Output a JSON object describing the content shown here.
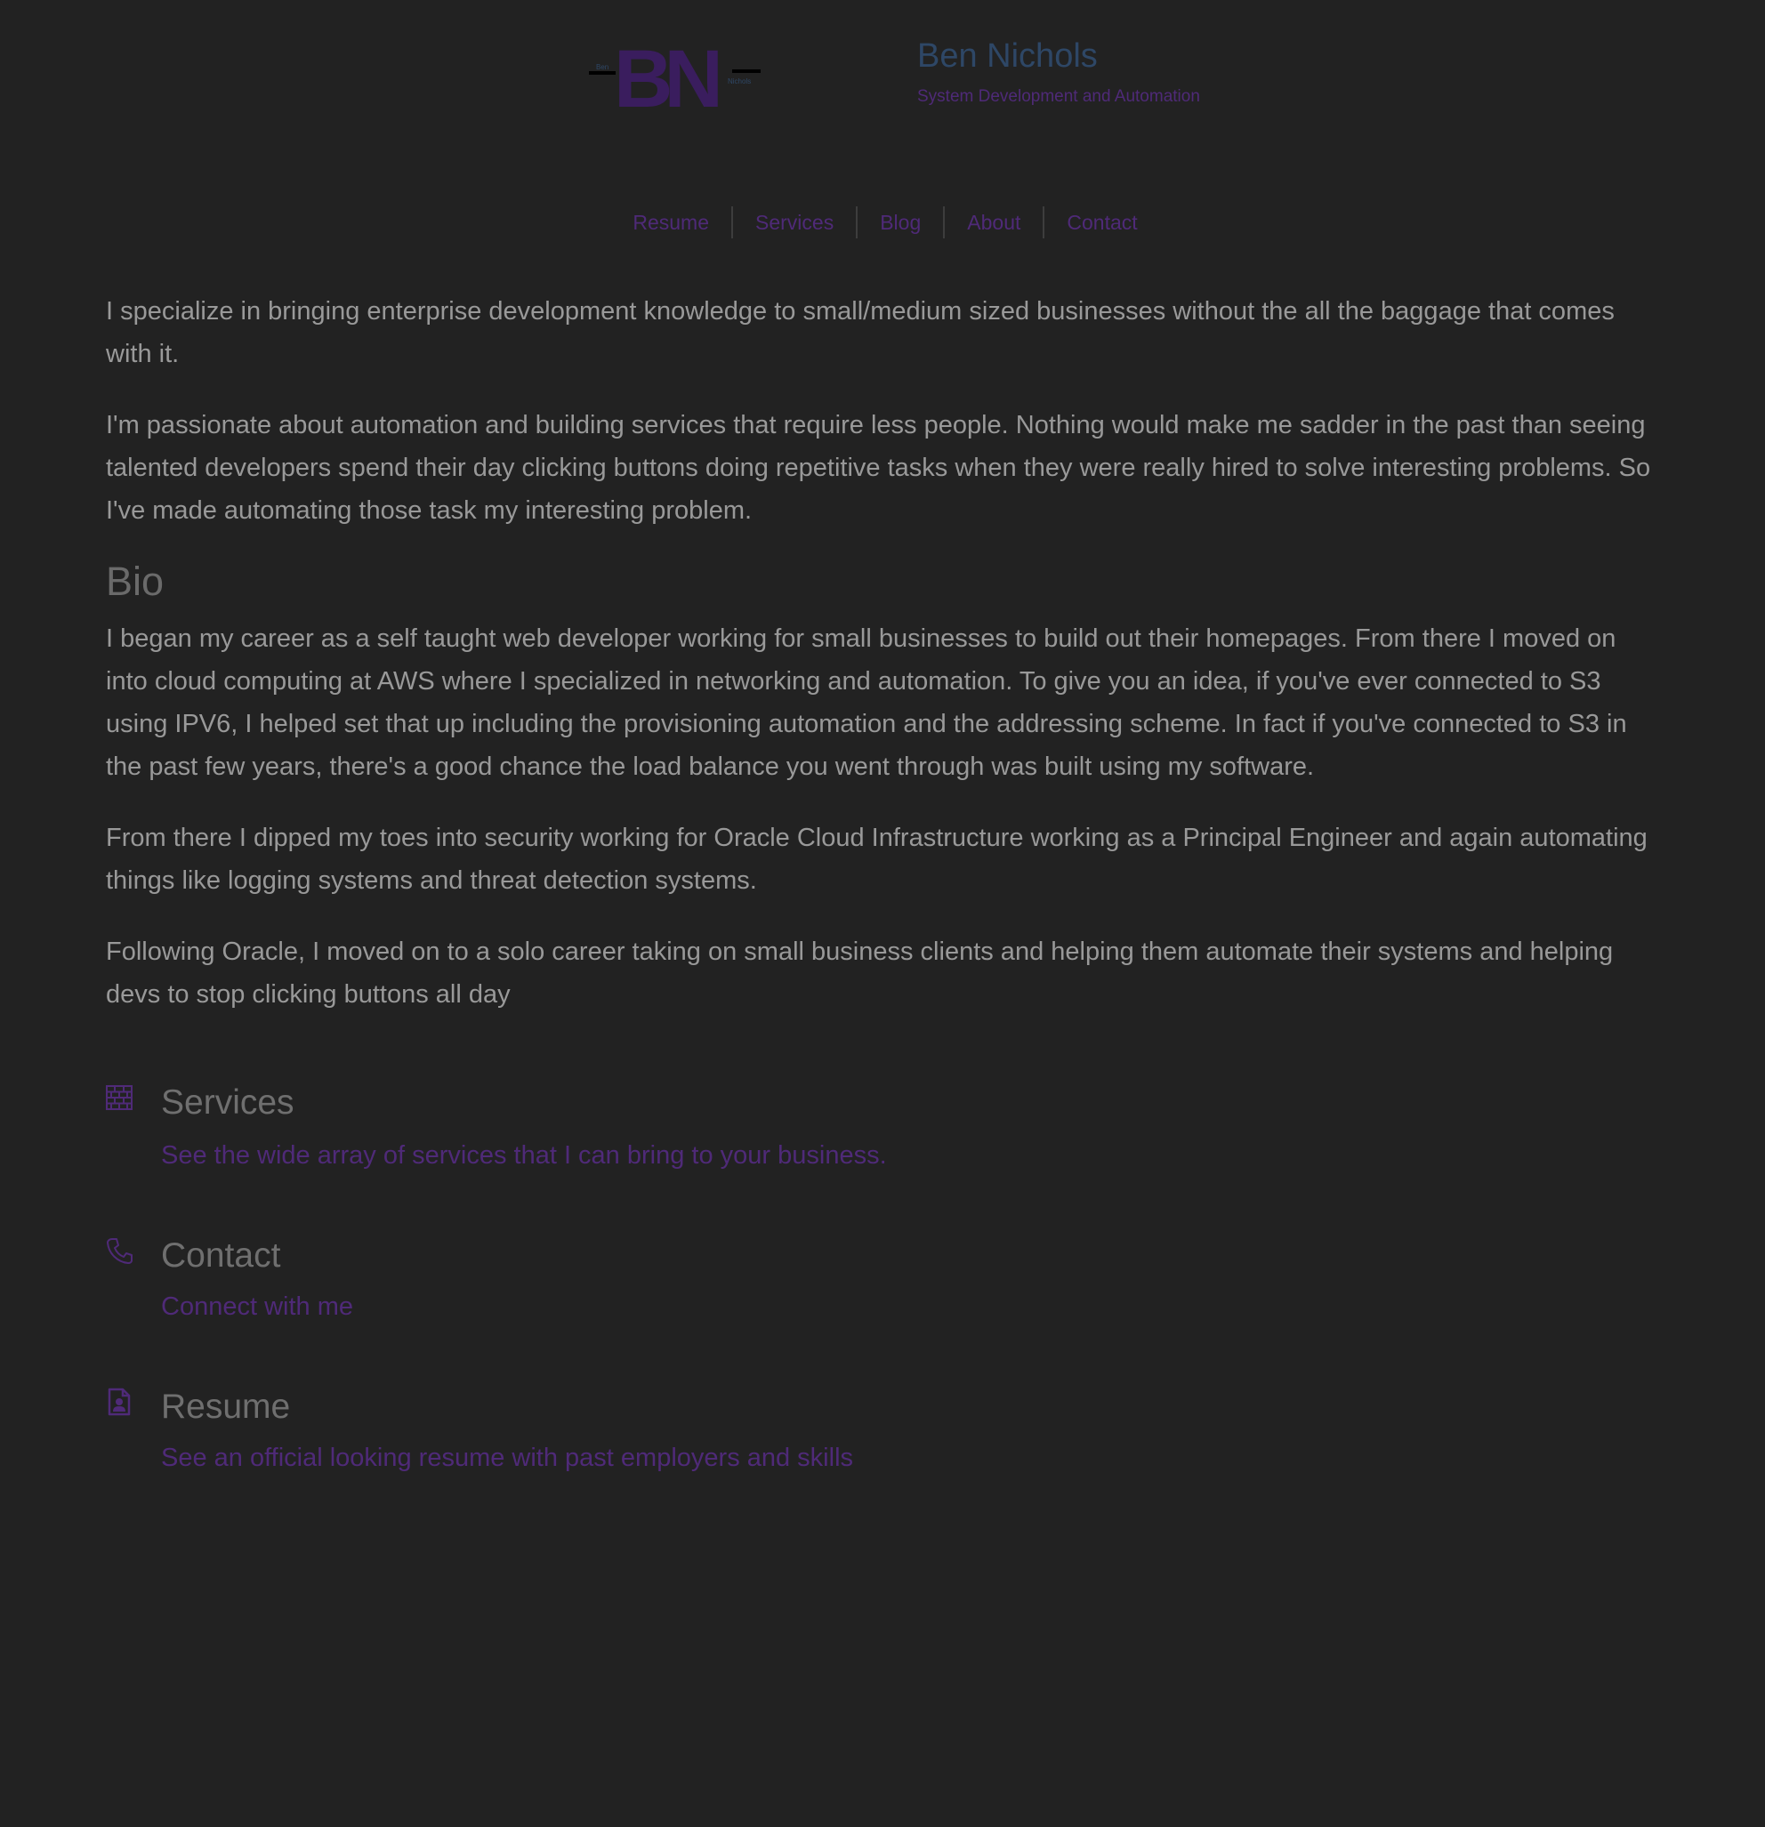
{
  "header": {
    "logo_text": "BN",
    "logo_small_left": "Ben",
    "logo_small_right": "Nichols",
    "site_name": "Ben Nichols",
    "tagline": "System Development and Automation"
  },
  "nav": {
    "items": [
      {
        "label": "Resume"
      },
      {
        "label": "Services"
      },
      {
        "label": "Blog"
      },
      {
        "label": "About"
      },
      {
        "label": "Contact"
      }
    ]
  },
  "main": {
    "intro": [
      "I specialize in bringing enterprise development knowledge to small/medium sized businesses without the all the baggage that comes with it.",
      "I'm passionate about automation and building services that require less people. Nothing would make me sadder in the past than seeing talented developers spend their day clicking buttons doing repetitive tasks when they were really hired to solve interesting problems. So I've made automating those task my interesting problem."
    ],
    "bio_heading": "Bio",
    "bio": [
      "I began my career as a self taught web developer working for small businesses to build out their homepages. From there I moved on into cloud computing at AWS where I specialized in networking and automation. To give you an idea, if you've ever connected to S3 using IPV6, I helped set that up including the provisioning automation and the addressing scheme. In fact if you've connected to S3 in the past few years, there's a good chance the load balance you went through was built using my software.",
      "From there I dipped my toes into security working for Oracle Cloud Infrastructure working as a Principal Engineer and again automating things like logging systems and threat detection systems.",
      "Following Oracle, I moved on to a solo career taking on small business clients and helping them automate their systems and helping devs to stop clicking buttons all day"
    ]
  },
  "features": [
    {
      "icon": "brick-wall-icon",
      "title": "Services",
      "link": "See the wide array of services that I can bring to your business."
    },
    {
      "icon": "phone-icon",
      "title": "Contact",
      "link": "Connect with me"
    },
    {
      "icon": "resume-file-icon",
      "title": "Resume",
      "link": "See an official looking resume with past employers and skills"
    }
  ],
  "colors": {
    "background": "#222222",
    "accent": "#4f2a78",
    "name": "#2e4766",
    "text": "#999999"
  }
}
